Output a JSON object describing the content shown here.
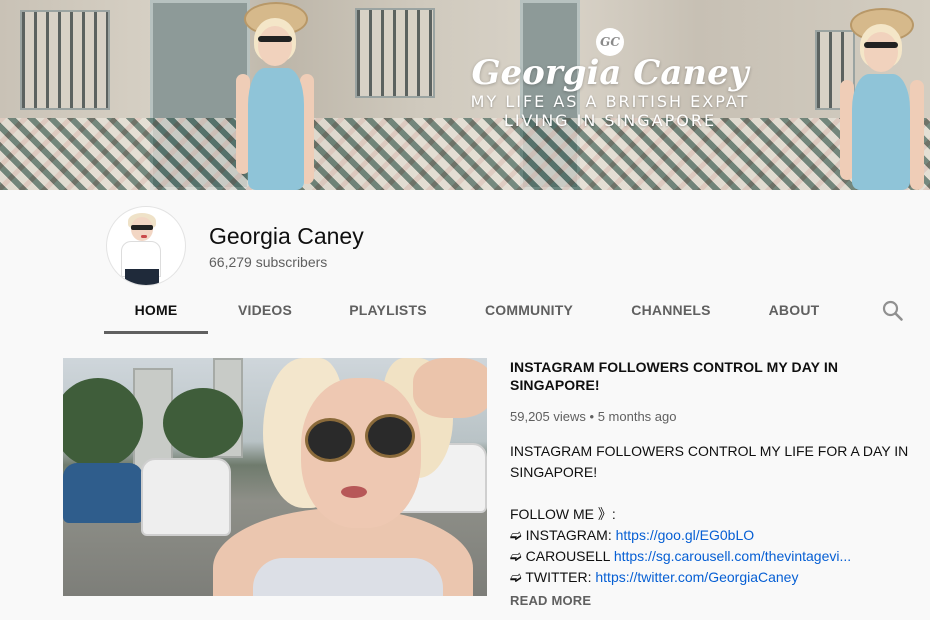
{
  "banner": {
    "badge": "GC",
    "name": "Georgia Caney",
    "tagline_1": "MY LIFE AS A BRITISH EXPAT",
    "tagline_2": "LIVING IN SINGAPORE"
  },
  "channel": {
    "name": "Georgia Caney",
    "subscribers": "66,279 subscribers"
  },
  "tabs": [
    {
      "label": "HOME",
      "active": true
    },
    {
      "label": "VIDEOS"
    },
    {
      "label": "PLAYLISTS"
    },
    {
      "label": "COMMUNITY"
    },
    {
      "label": "CHANNELS"
    },
    {
      "label": "ABOUT"
    }
  ],
  "search_icon": "search-icon",
  "featured": {
    "title": "INSTAGRAM FOLLOWERS CONTROL MY DAY IN SINGAPORE!",
    "views": "59,205 views",
    "separator": "•",
    "age": "5 months ago",
    "description": {
      "line1": "INSTAGRAM FOLLOWERS CONTROL MY LIFE FOR A DAY IN",
      "line2": "SINGAPORE!",
      "follow": "FOLLOW ME 》:",
      "links": [
        {
          "arrow": "➫",
          "label": "INSTAGRAM:",
          "url": "https://goo.gl/EG0bLO"
        },
        {
          "arrow": "➫",
          "label": "CAROUSELL",
          "url": "https://sg.carousell.com/thevintagevi..."
        },
        {
          "arrow": "➫",
          "label": "TWITTER:",
          "url": "https://twitter.com/GeorgiaCaney"
        }
      ]
    },
    "read_more": "READ MORE"
  },
  "colors": {
    "link": "#065fd4",
    "text_primary": "#0f0f0f",
    "text_secondary": "#606060",
    "background": "#f9f9f9"
  }
}
